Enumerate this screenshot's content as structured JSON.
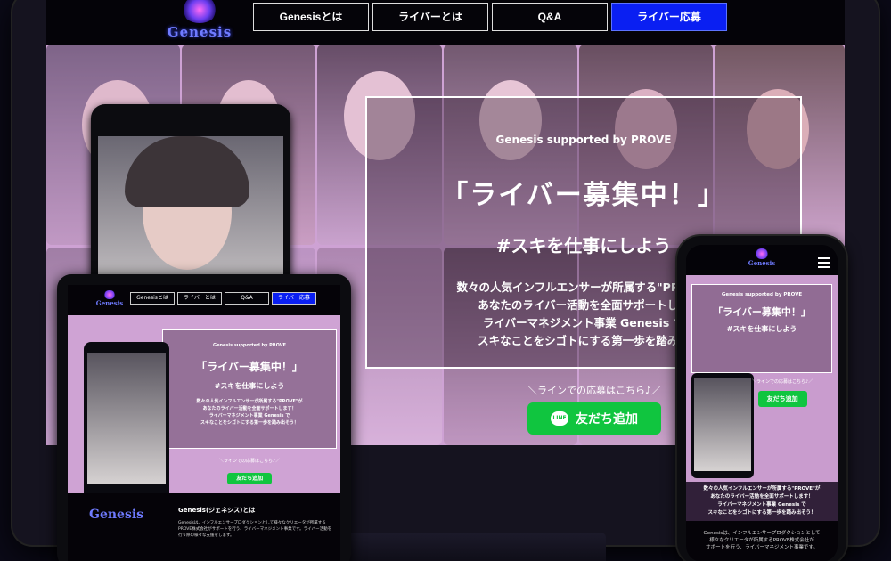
{
  "desktop": {
    "logo_text": "Genesis",
    "nav": [
      {
        "label": "Genesisとは"
      },
      {
        "label": "ライバーとは"
      },
      {
        "label": "Q&A"
      },
      {
        "label": "ライバー応募"
      }
    ],
    "hero": {
      "supported": "Genesis supported by PROVE",
      "headline": "「ライバー募集中！」",
      "tagline": "#スキを仕事にしよう",
      "desc_lines": [
        "数々の人気インフルエンサーが所属する\"PROVE\"",
        "あなたのライバー活動を全面サポートしま",
        "ライバーマネジメント事業 Genesis で",
        "スキなことをシゴトにする第一歩を踏み出"
      ],
      "line_caption": "＼ラインでの応募はこちら♪／",
      "line_button": "友だち追加",
      "line_icon_text": "LINE"
    }
  },
  "tablet": {
    "logo_text": "Genesis",
    "nav": [
      {
        "label": "Genesisとは"
      },
      {
        "label": "ライバーとは"
      },
      {
        "label": "Q&A"
      },
      {
        "label": "ライバー応募"
      }
    ],
    "hero": {
      "supported": "Genesis supported by PROVE",
      "headline": "「ライバー募集中！」",
      "tagline": "#スキを仕事にしよう",
      "desc_lines": [
        "数々の人気インフルエンサーが所属する\"PROVE\"が",
        "あなたのライバー活動を全面サポートします！",
        "ライバーマネジメント事業 Genesis で",
        "スキなことをシゴトにする第一歩を踏み出そう！"
      ],
      "line_caption": "＼ラインでの応募はこちら♪／",
      "line_button": "友だち追加"
    },
    "about": {
      "logo": "Genesis",
      "title": "Genesis(ジェネシス)とは",
      "body": "Genesisは、インフルエンサープロダクションとして様々なクリエータが所属するPROVE株式会社がサポートを行う、ライバーマネジメント事業です。ライバー活動を行う際の様々な支援をします。"
    }
  },
  "mobile": {
    "logo_text": "Genesis",
    "hero": {
      "supported": "Genesis supported by PROVE",
      "headline": "「ライバー募集中！」",
      "tagline": "#スキを仕事にしよう",
      "line_caption": "＼ラインでの応募はこちら♪／",
      "line_button": "友だち追加",
      "desc_lines": [
        "数々の人気インフルエンサーが所属する\"PROVE\"が",
        "あなたのライバー活動を全面サポートします！",
        "ライバーマネジメント事業 Genesis で",
        "スキなことをシゴトにする第一歩を踏み出そう！"
      ]
    },
    "about_lines": [
      "Genesisは、インフルエンサープロダクションとして",
      "様々なクリエータが所属するPROVE株式会社が",
      "サポートを行う、ライバーマネジメント事業です。"
    ]
  },
  "colors": {
    "accent_blue": "#0a1ff2",
    "line_green": "#10c53f",
    "hero_pink": "#c9a0cf",
    "logo_blue": "#6f7bff"
  }
}
